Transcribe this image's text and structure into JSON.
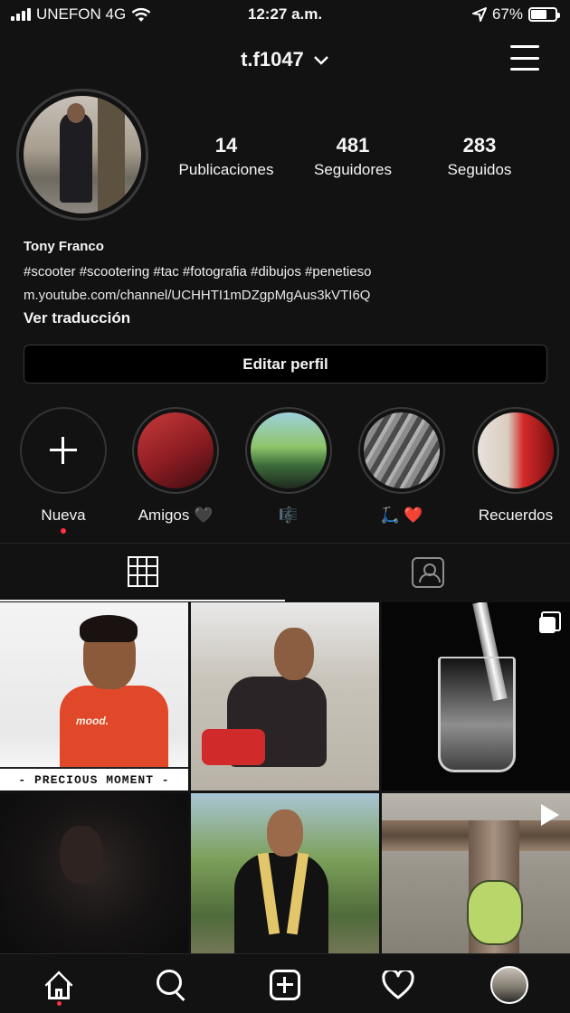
{
  "status_bar": {
    "carrier": "UNEFON 4G",
    "time": "12:27 a.m.",
    "battery": "67%",
    "battery_level": 0.67,
    "icons": [
      "signal-icon",
      "wifi-icon",
      "location-arrow-icon",
      "battery-icon"
    ]
  },
  "header": {
    "username": "t.f1047",
    "dropdown_icon": "chevron-down-icon",
    "menu_icon": "hamburger-menu-icon"
  },
  "profile": {
    "stats": [
      {
        "count": "14",
        "label": "Publicaciones"
      },
      {
        "count": "481",
        "label": "Seguidores"
      },
      {
        "count": "283",
        "label": "Seguidos"
      }
    ],
    "name": "Tony Franco",
    "bio_tags": "#scooter #scootering #tac #fotografia #dibujos #penetieso",
    "bio_link": "m.youtube.com/channel/UCHHTI1mDZgpMgAus3kVTI6Q",
    "translate_label": "Ver traducción",
    "edit_button": "Editar perfil"
  },
  "highlights": [
    {
      "label": "Nueva",
      "icon": "plus-icon"
    },
    {
      "label": "Amigos 🖤"
    },
    {
      "label": "🎼"
    },
    {
      "label": "🛴 ❤️"
    },
    {
      "label": "Recuerdos"
    }
  ],
  "tabs": [
    {
      "icon": "grid-icon",
      "active": true
    },
    {
      "icon": "tagged-photos-icon",
      "active": false
    }
  ],
  "posts": [
    {
      "caption": "- PRECIOUS MOMENT -",
      "shirt_text": "mood."
    },
    {},
    {
      "icon": "multiple-photos-icon"
    },
    {},
    {},
    {
      "icon": "video-play-icon"
    }
  ],
  "bottom_nav": [
    "home-icon",
    "search-icon",
    "new-post-icon",
    "activity-heart-icon",
    "profile-avatar-icon"
  ],
  "colors": {
    "background": "#121212",
    "notification_dot": "#ff3040",
    "border": "#3a3a3a"
  }
}
